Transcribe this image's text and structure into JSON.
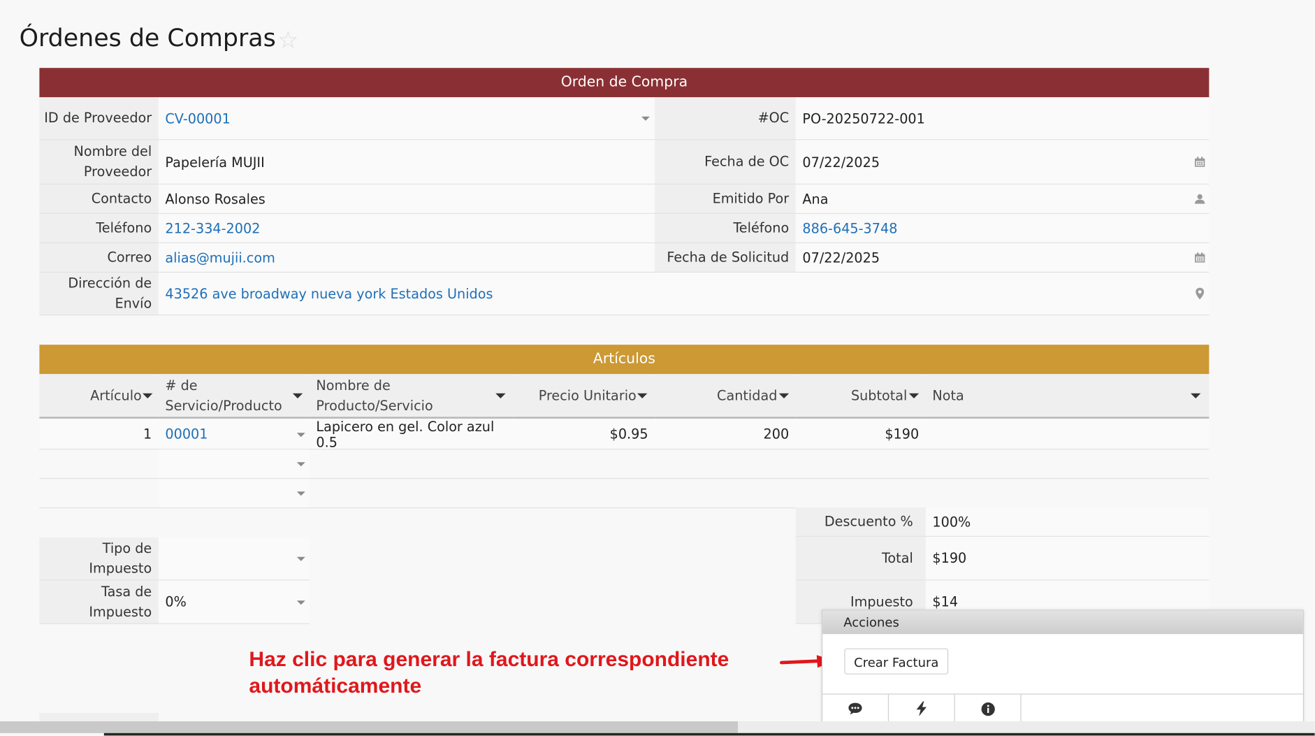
{
  "page": {
    "title": "Órdenes de Compras"
  },
  "order_section": {
    "header": "Orden de Compra",
    "left_fields": [
      {
        "label": "ID de Proveedor",
        "value": "CV-00001"
      },
      {
        "label": "Nombre del Proveedor",
        "value": "Papelería MUJII"
      },
      {
        "label": "Contacto",
        "value": "Alonso Rosales"
      },
      {
        "label": "Teléfono",
        "value": "212-334-2002"
      },
      {
        "label": "Correo",
        "value": "alias@mujii.com"
      },
      {
        "label": "Dirección de Envío",
        "value": "43526 ave broadway nueva york Estados Unidos"
      }
    ],
    "right_fields": [
      {
        "label": "#OC",
        "value": "PO-20250722-001"
      },
      {
        "label": "Fecha de OC",
        "value": "07/22/2025"
      },
      {
        "label": "Emitido Por",
        "value": "Ana"
      },
      {
        "label": "Teléfono",
        "value": "886-645-3748"
      },
      {
        "label": "Fecha de Solicitud",
        "value": "07/22/2025"
      }
    ]
  },
  "items_section": {
    "header": "Artículos",
    "columns": [
      "Artículo",
      "# de Servicio/Producto",
      "Nombre de Producto/Servicio",
      "Precio Unitario",
      "Cantidad",
      "Subtotal",
      "Nota"
    ],
    "rows": [
      {
        "articulo": "1",
        "servicio": "00001",
        "nombre": "Lapicero en gel. Color azul 0.5",
        "precio": "$0.95",
        "cantidad": "200",
        "subtotal": "$190",
        "nota": ""
      }
    ]
  },
  "tax": {
    "tipo_label": "Tipo de Impuesto",
    "tipo_value": "",
    "tasa_label": "Tasa de Impuesto",
    "tasa_value": "0%"
  },
  "totals": [
    {
      "label": "Descuento %",
      "value": "100%"
    },
    {
      "label": "Total",
      "value": "$190"
    },
    {
      "label": "Impuesto",
      "value": "$14"
    }
  ],
  "actions_panel": {
    "title": "Acciones",
    "button": "Crear Factura"
  },
  "annotation": {
    "text": "Haz clic para generar la factura correspondiente automáticamente"
  },
  "colors": {
    "order_header": "#8a3034",
    "items_header": "#cc9934",
    "link": "#1e6fb8",
    "annotation": "#e0171c"
  }
}
